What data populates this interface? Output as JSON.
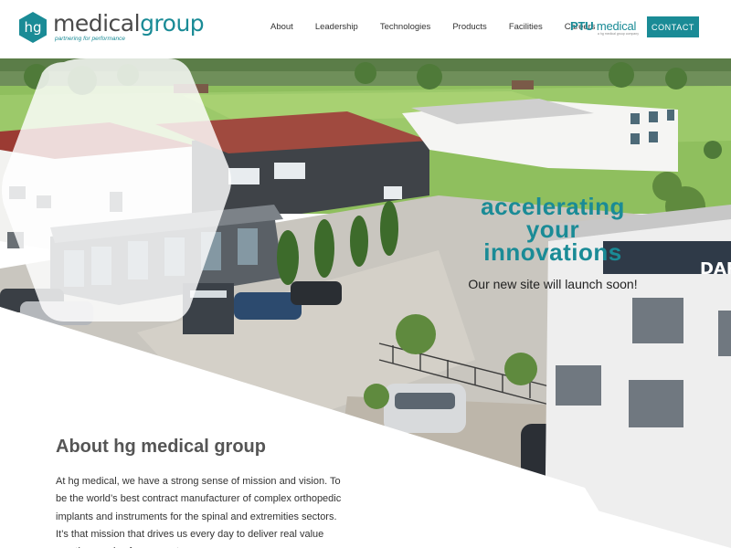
{
  "header": {
    "logo": {
      "badge_text": "hg",
      "name_part1": "medical",
      "name_part2": "group",
      "tagline": "partnering for performance"
    },
    "nav": [
      {
        "label": "About"
      },
      {
        "label": "Leadership"
      },
      {
        "label": "Technologies"
      },
      {
        "label": "Products"
      },
      {
        "label": "Facilities"
      },
      {
        "label": "Careers"
      }
    ],
    "ptu": {
      "bold": "PTU",
      "light": "medical",
      "sub": "a hg medical group company"
    },
    "contact_label": "CONTACT"
  },
  "hero": {
    "headline_line1": "accelerating",
    "headline_line2": "your",
    "headline_line3": "innovations",
    "subtext": "Our new site will launch soon!",
    "building_sign": "DARCO"
  },
  "about": {
    "title": "About hg medical group",
    "body": "At hg medical, we have a strong sense of mission and vision. To be the world’s best contract manufacturer of complex orthopedic implants and instruments for the spinal and extremities sectors. It’s that mission that drives us every day to deliver real value creating service for our customers."
  },
  "colors": {
    "accent": "#1a8b96",
    "text": "#333333",
    "heading": "#555555"
  }
}
